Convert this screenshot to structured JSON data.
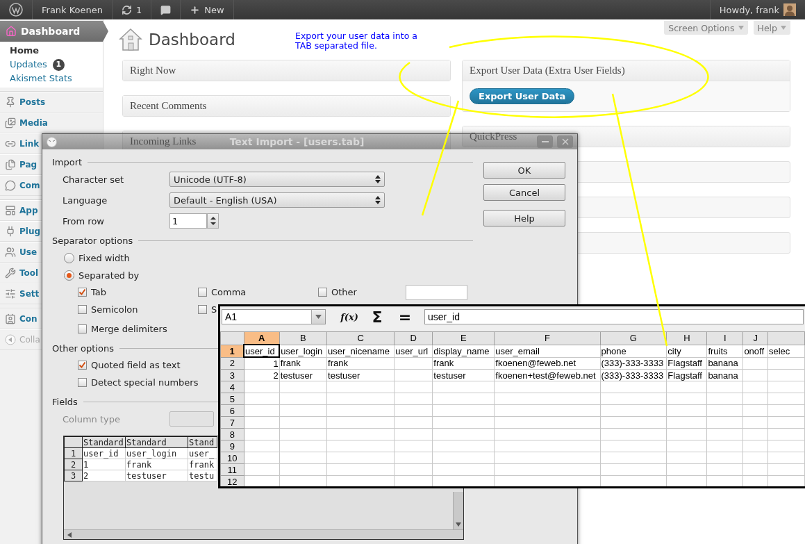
{
  "admin_bar": {
    "site_name": "Frank Koenen",
    "updates_count": "1",
    "new_label": "New",
    "greeting": "Howdy, frank"
  },
  "sidebar": {
    "header": {
      "label": "Dashboard",
      "selected": true
    },
    "submenu": [
      {
        "label": "Home",
        "selected": true
      },
      {
        "label": "Updates",
        "badge": "1",
        "selected": false
      },
      {
        "label": "Akismet Stats",
        "selected": false
      }
    ],
    "menu_groups": [
      [
        {
          "label": "Posts"
        },
        {
          "label": "Media"
        },
        {
          "label": "Link"
        },
        {
          "label": "Pag"
        },
        {
          "label": "Com"
        }
      ],
      [
        {
          "label": "App"
        },
        {
          "label": "Plug"
        },
        {
          "label": "Use"
        },
        {
          "label": "Tool"
        },
        {
          "label": "Sett"
        }
      ],
      [
        {
          "label": "Con"
        }
      ]
    ],
    "collapse": "Colla"
  },
  "screen_tabs": [
    "Screen Options",
    "Help"
  ],
  "page_title": "Dashboard",
  "annotation": {
    "lines": [
      "Export your user data into a",
      "TAB separated file."
    ]
  },
  "left_boxes": [
    {
      "kind": "box",
      "title": "Right Now"
    },
    {
      "kind": "box",
      "title": "Recent Comments"
    },
    {
      "kind": "box",
      "title": "Incoming Links"
    }
  ],
  "right_boxes": [
    {
      "kind": "button_box",
      "title": "Export User Data (Extra User Fields)",
      "button": "Export User Data"
    },
    {
      "kind": "box",
      "title": "QuickPress"
    },
    {
      "kind": "box"
    },
    {
      "kind": "box"
    },
    {
      "kind": "box"
    }
  ],
  "dialog": {
    "title": "Text Import - [users.tab]",
    "import": {
      "legend": "Import",
      "character_set": {
        "label": "Character set",
        "value": "Unicode (UTF-8)"
      },
      "language": {
        "label": "Language",
        "value": "Default - English (USA)"
      },
      "from_row": {
        "label": "From row",
        "value": "1"
      }
    },
    "separator": {
      "legend": "Separator options",
      "modes": [
        {
          "label": "Fixed width",
          "selected": false
        },
        {
          "label": "Separated by",
          "selected": true
        }
      ],
      "separators": [
        {
          "label": "Tab",
          "checked": true
        },
        {
          "label": "Comma",
          "checked": false
        },
        {
          "label": "Other",
          "checked": false
        },
        {
          "label": "Semicolon",
          "checked": false
        },
        {
          "label": "S",
          "checked": false
        }
      ],
      "merge_delimiters": {
        "label": "Merge delimiters",
        "checked": false
      }
    },
    "other": {
      "legend": "Other options",
      "options": [
        {
          "label": "Quoted field as text",
          "checked": true
        },
        {
          "label": "Detect special numbers",
          "checked": false
        }
      ]
    },
    "fields": {
      "legend": "Fields",
      "column_type": {
        "label": "Column type",
        "disabled": true
      },
      "preview": {
        "columns": [
          "Standard",
          "Standard",
          "Stand"
        ],
        "rows": [
          {
            "number": "1",
            "cells": [
              "user_id",
              "user_login",
              "user_"
            ]
          },
          {
            "number": "2",
            "cells": [
              "1",
              "frank",
              "frank"
            ]
          },
          {
            "number": "3",
            "cells": [
              "2",
              "testuser",
              "testu"
            ]
          }
        ]
      }
    },
    "buttons": [
      "OK",
      "Cancel",
      "Help"
    ]
  },
  "spreadsheet": {
    "name_box": "A1",
    "formula_buttons": [
      "f(x)",
      "Σ",
      "="
    ],
    "formula": "user_id",
    "columns": [
      {
        "label": "A",
        "selected": true
      },
      {
        "label": "B",
        "selected": false
      },
      {
        "label": "C",
        "selected": false
      },
      {
        "label": "D",
        "selected": false
      },
      {
        "label": "E",
        "selected": false
      },
      {
        "label": "F",
        "selected": false
      },
      {
        "label": "G",
        "selected": false
      },
      {
        "label": "H",
        "selected": false
      },
      {
        "label": "I",
        "selected": false
      },
      {
        "label": "J",
        "selected": false
      },
      {
        "selected": false
      }
    ],
    "rows": [
      {
        "number": "1",
        "selected": true,
        "cells": [
          "user_id",
          "user_login",
          "user_nicename",
          "user_url",
          "display_name",
          "user_email",
          "phone",
          "city",
          "fruits",
          "onoff",
          "selec"
        ]
      },
      {
        "number": "2",
        "selected": false,
        "cells": [
          "1",
          "frank",
          "frank",
          null,
          "frank",
          "fkoenen@feweb.net",
          "(333)-333-3333",
          "Flagstaff",
          "banana",
          null,
          null
        ]
      },
      {
        "number": "3",
        "selected": false,
        "cells": [
          "2",
          "testuser",
          "testuser",
          null,
          "testuser",
          "fkoenen+test@feweb.net",
          "(333)-333-3333",
          "Flagstaff",
          "banana",
          null,
          null
        ]
      },
      {
        "number": "4",
        "selected": false
      },
      {
        "number": "5",
        "selected": false
      },
      {
        "number": "6",
        "selected": false
      },
      {
        "number": "7",
        "selected": false
      },
      {
        "number": "8",
        "selected": false
      },
      {
        "number": "9",
        "selected": false
      },
      {
        "number": "10",
        "selected": false
      },
      {
        "number": "11",
        "selected": false
      },
      {
        "number": "12",
        "selected": false
      }
    ]
  }
}
